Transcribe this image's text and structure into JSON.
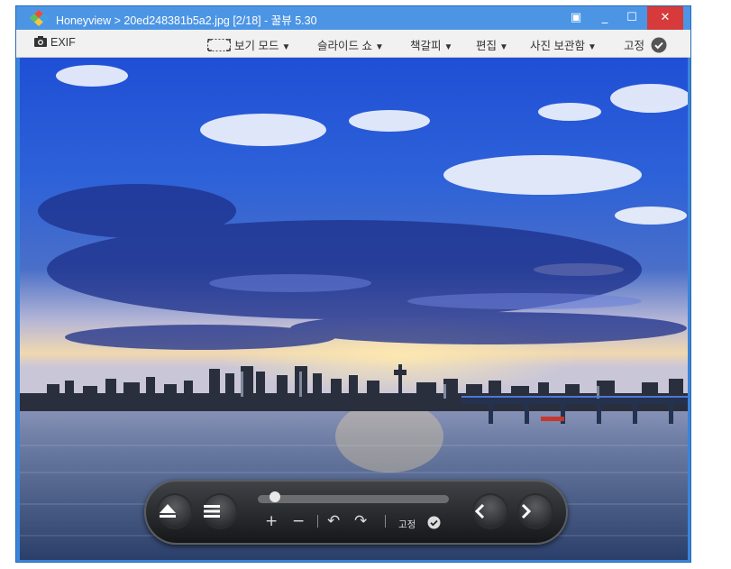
{
  "window": {
    "title": "Honeyview > 20ed248381b5a2.jpg [2/18] - 꿀뷰 5.30",
    "buttons": {
      "pin": "▣",
      "minimize": "_",
      "maximize": "☐",
      "close": "✕"
    }
  },
  "toolbar": {
    "exif_label": "EXIF",
    "view_mode_label": "보기 모드",
    "slideshow_label": "슬라이드 쇼",
    "bookmark_label": "책갈피",
    "edit_label": "편집",
    "photo_vault_label": "사진 보관함",
    "pin_label": "고정",
    "dropdown_arrow": "▼"
  },
  "controls": {
    "pin_label": "고정",
    "zoom_in": "+",
    "zoom_out": "−",
    "rotate_left": "↶",
    "rotate_right": "↷",
    "slider_fraction": 0.06
  },
  "colors": {
    "titlebar": "#4c95e5",
    "close_button": "#d63a3a",
    "toolbar_bg": "#f1f1f1"
  }
}
